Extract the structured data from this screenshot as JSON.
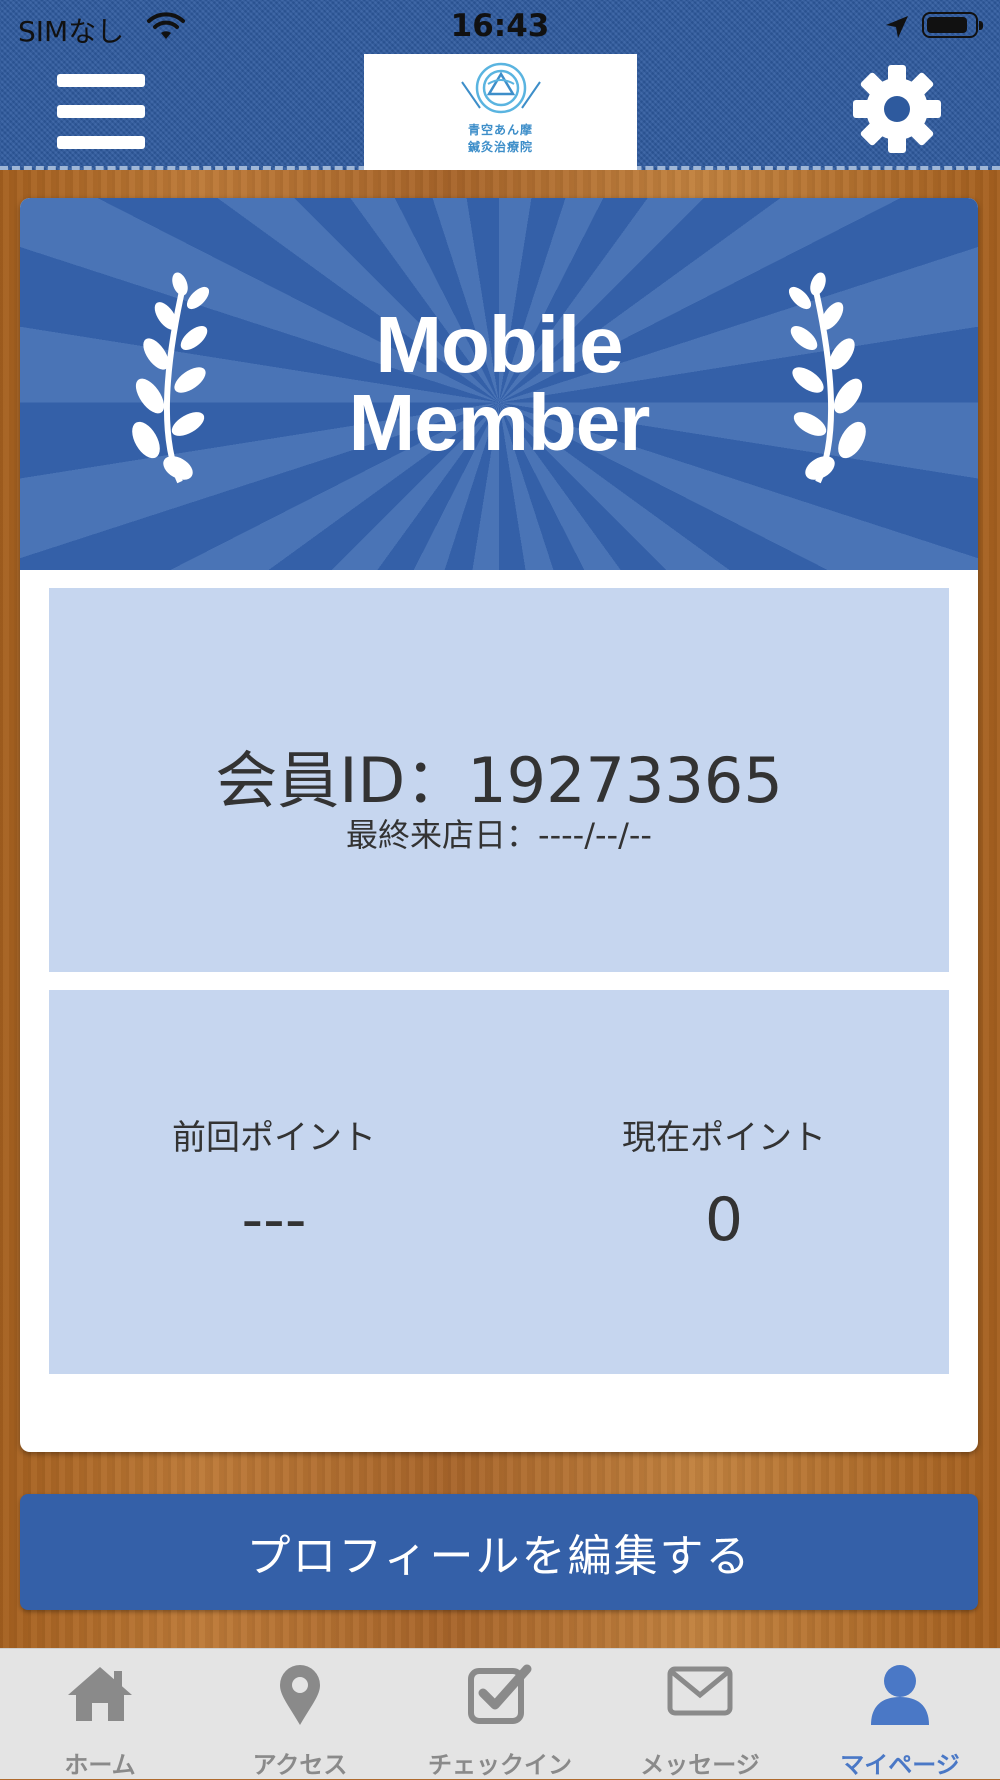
{
  "status_bar": {
    "carrier": "SIMなし",
    "time": "16:43"
  },
  "header": {
    "logo_text_line1": "青空あん摩",
    "logo_text_line2": "鍼灸治療院",
    "menu_icon": "hamburger-menu-icon",
    "settings_icon": "gear-icon"
  },
  "member_card": {
    "banner_line1": "Mobile",
    "banner_line2": "Member",
    "member_id": "会員ID：19273365",
    "last_visit": "最終来店日：----/--/--",
    "previous_points_label": "前回ポイント",
    "previous_points_value": "---",
    "current_points_label": "現在ポイント",
    "current_points_value": "0"
  },
  "profile_button_label": "プロフィールを編集する",
  "tabs": [
    {
      "label": "ホーム",
      "icon": "home-icon",
      "active": false
    },
    {
      "label": "アクセス",
      "icon": "map-pin-icon",
      "active": false
    },
    {
      "label": "チェックイン",
      "icon": "checkbox-icon",
      "active": false
    },
    {
      "label": "メッセージ",
      "icon": "envelope-icon",
      "active": false
    },
    {
      "label": "マイページ",
      "icon": "user-icon",
      "active": true
    }
  ],
  "colors": {
    "header_blue": "#2e5a9e",
    "banner_blue": "#3460a8",
    "panel_blue": "#c6d6ef",
    "active_tab": "#4a78c6",
    "inactive_tab": "#8a8a8a"
  }
}
